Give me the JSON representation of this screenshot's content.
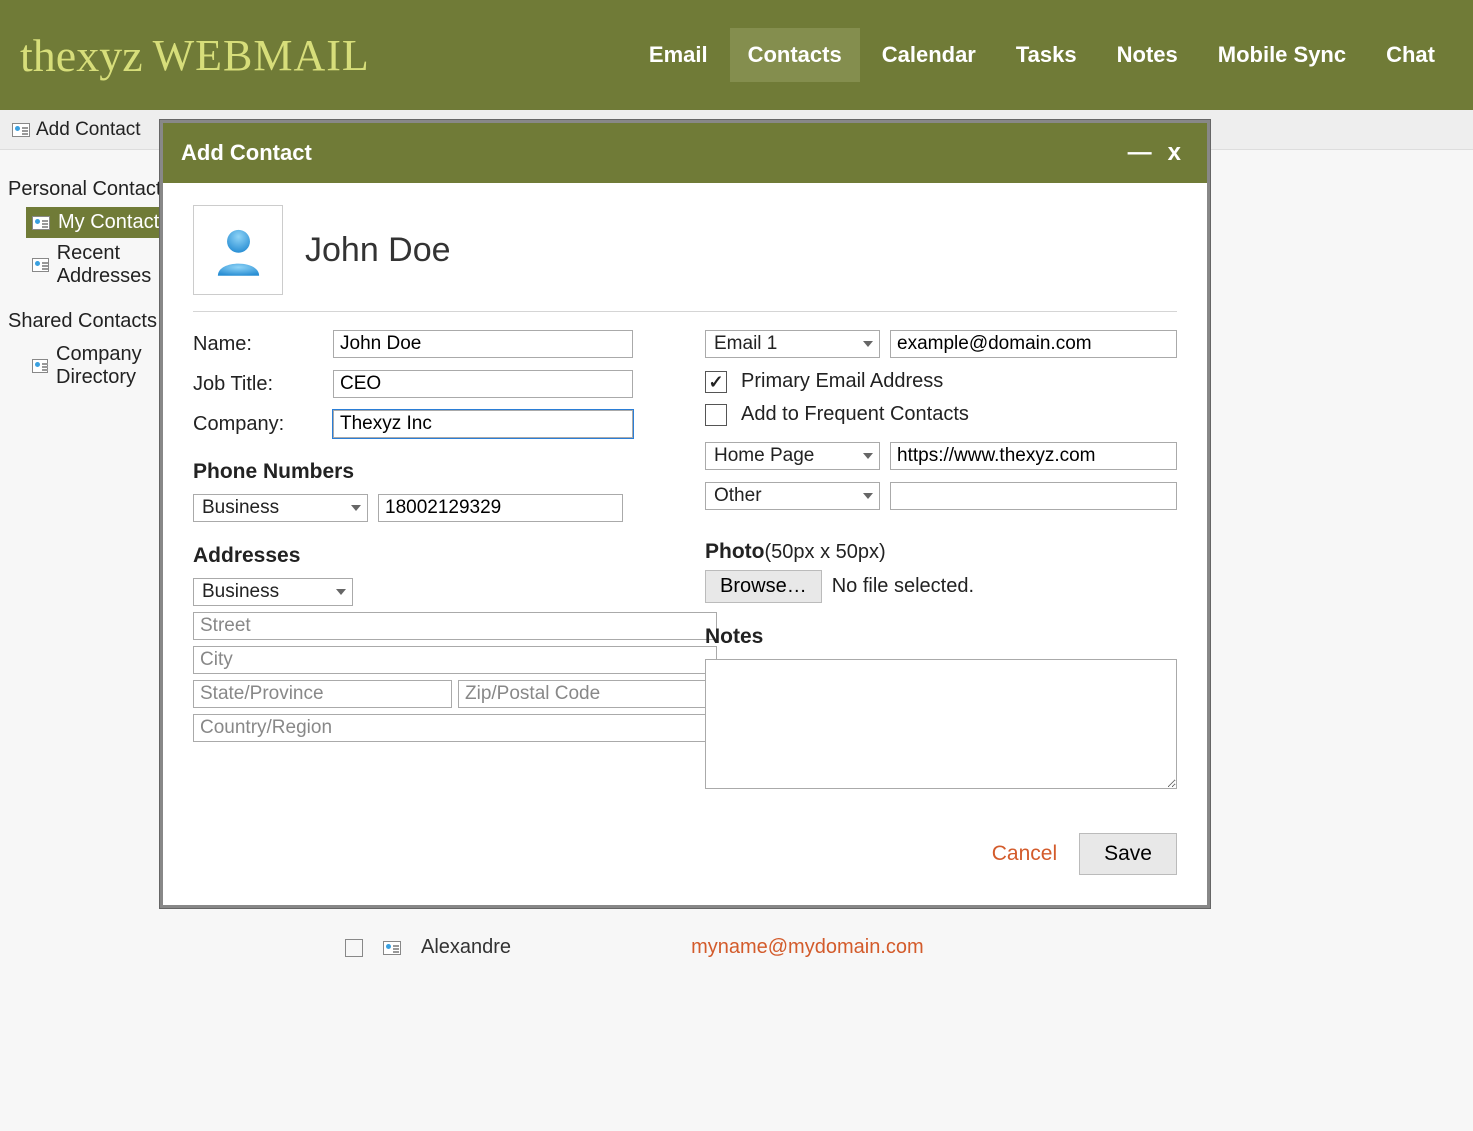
{
  "brand": {
    "part1": "thexyz",
    "part2": "WEBMAIL"
  },
  "nav": {
    "email": "Email",
    "contacts": "Contacts",
    "calendar": "Calendar",
    "tasks": "Tasks",
    "notes": "Notes",
    "mobile_sync": "Mobile Sync",
    "chat": "Chat"
  },
  "toolbar": {
    "add_contact": "Add Contact"
  },
  "sidebar": {
    "personal_title": "Personal Contacts",
    "my_contacts": "My Contacts",
    "recent": "Recent Addresses",
    "shared_title": "Shared Contacts",
    "company": "Company Directory"
  },
  "dialog": {
    "title": "Add Contact",
    "contact_name": "John Doe",
    "labels": {
      "name": "Name:",
      "job_title": "Job Title:",
      "company": "Company:",
      "phone_section": "Phone Numbers",
      "addresses_section": "Addresses",
      "primary_email": "Primary Email Address",
      "add_frequent": "Add to Frequent Contacts",
      "photo": "Photo",
      "photo_hint": "(50px x 50px)",
      "no_file": "No file selected.",
      "notes": "Notes",
      "browse": "Browse…",
      "cancel": "Cancel",
      "save": "Save"
    },
    "fields": {
      "name": "John Doe",
      "job_title": "CEO",
      "company": "Thexyz Inc",
      "phone_type": "Business",
      "phone_value": "18002129329",
      "address_type": "Business",
      "email_type": "Email 1",
      "email_value": "example@domain.com",
      "homepage_type": "Home Page",
      "homepage_value": "https://www.thexyz.com",
      "other_type": "Other",
      "other_value": "",
      "primary_checked": true,
      "frequent_checked": false
    },
    "placeholders": {
      "street": "Street",
      "city": "City",
      "state": "State/Province",
      "zip": "Zip/Postal Code",
      "country": "Country/Region"
    }
  },
  "ghost_row": {
    "name": "Alexandre",
    "email": "myname@mydomain.com"
  }
}
